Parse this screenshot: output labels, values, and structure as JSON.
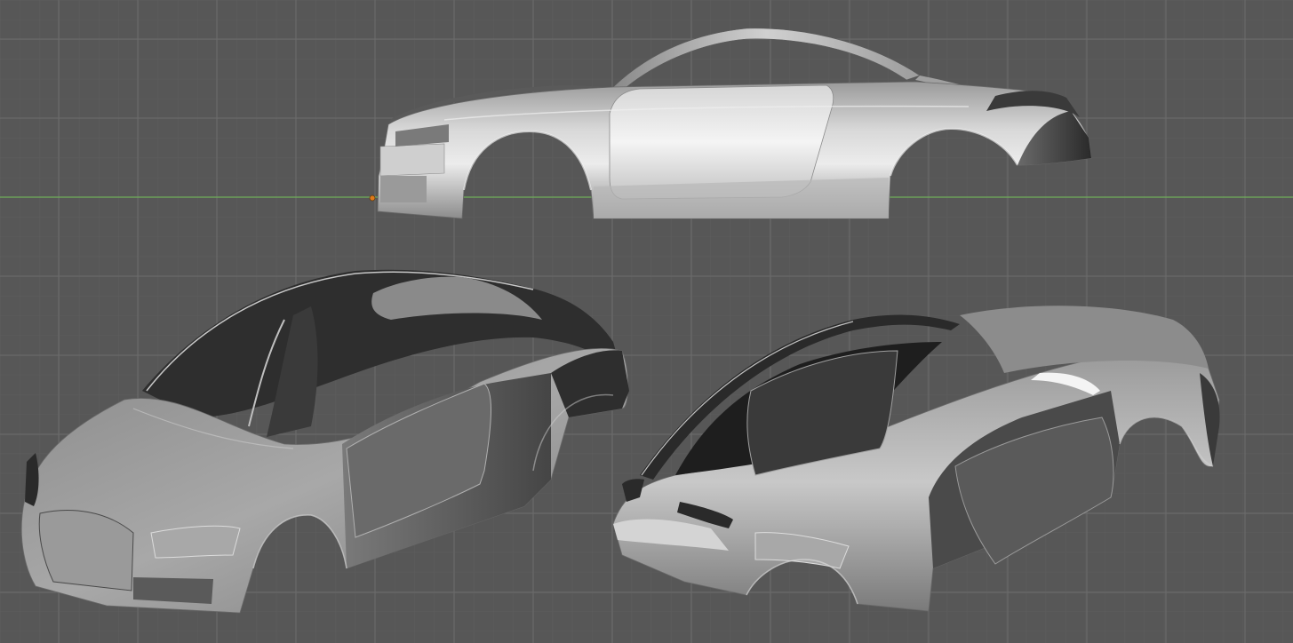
{
  "viewport": {
    "background_color": "#575757",
    "grid_minor_color": "#5e5e5e",
    "grid_major_color": "#6a6a6a",
    "axis_x_color": "#6fae5a",
    "origin_marker_color": "#e07a1a"
  },
  "scene": {
    "objects": [
      {
        "name": "car-body-side-view",
        "shading": "smooth-gray"
      },
      {
        "name": "car-body-front-perspective",
        "shading": "smooth-gray"
      },
      {
        "name": "car-body-rear-perspective",
        "shading": "smooth-gray"
      }
    ]
  }
}
